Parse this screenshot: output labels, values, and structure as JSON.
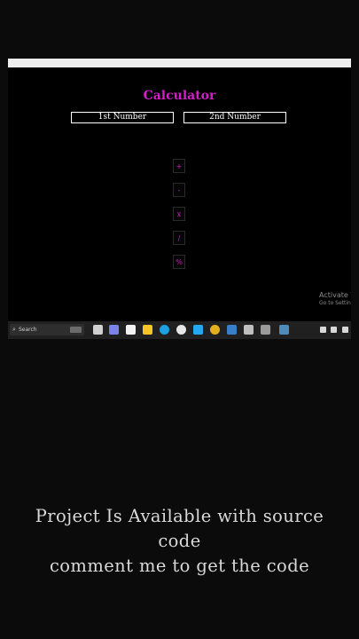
{
  "app": {
    "title": "Calculator",
    "inputs": [
      {
        "placeholder": "1st Number"
      },
      {
        "placeholder": "2nd Number"
      }
    ],
    "operations": [
      "+",
      "-",
      "x",
      "/",
      "%"
    ]
  },
  "watermark": {
    "line1": "Activate Windows",
    "line2": "Go to Settings to activate Windows."
  },
  "taskbar": {
    "search_label": "Search"
  },
  "caption": {
    "line1": "Project Is Available with source",
    "line2": "code",
    "line3": "comment me to get the code"
  },
  "colors": {
    "accent": "#d21fc8",
    "background": "#000000",
    "text": "#ffffff"
  }
}
